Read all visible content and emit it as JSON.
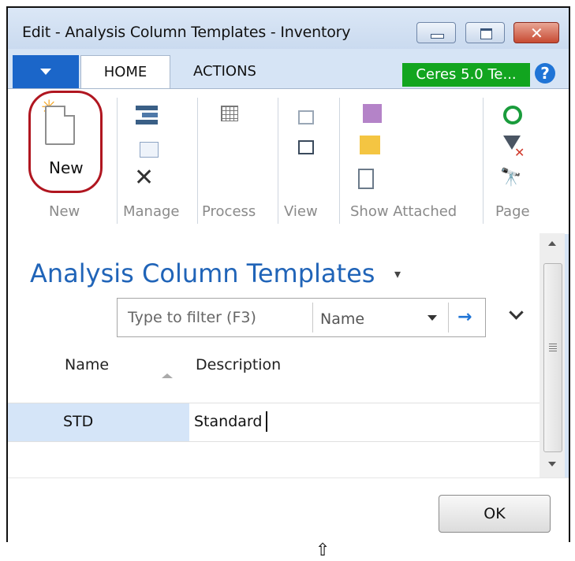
{
  "window": {
    "title": "Edit - Analysis Column Templates - Inventory",
    "close_glyph": "✕"
  },
  "ribbon": {
    "tabs": [
      {
        "label": "HOME"
      },
      {
        "label": "ACTIONS"
      }
    ],
    "company": "Ceres 5.0 Te...",
    "help": "?",
    "new_label": "New",
    "groups": [
      "New",
      "Manage",
      "Process",
      "View",
      "Show Attached",
      "Page"
    ]
  },
  "page": {
    "title": "Analysis Column Templates",
    "title_caret": "▾"
  },
  "filter": {
    "placeholder": "Type to filter (F3)",
    "field": "Name",
    "go_icon": "→"
  },
  "table": {
    "columns": [
      "Name",
      "Description"
    ],
    "rows": [
      {
        "name": "STD",
        "description": "Standard"
      }
    ]
  },
  "footer": {
    "ok_label": "OK"
  },
  "icons": {
    "new_star": "✳",
    "delete": "✕",
    "find": "🔭",
    "filter_clear": "✕",
    "resize_cursor": "⇧"
  }
}
